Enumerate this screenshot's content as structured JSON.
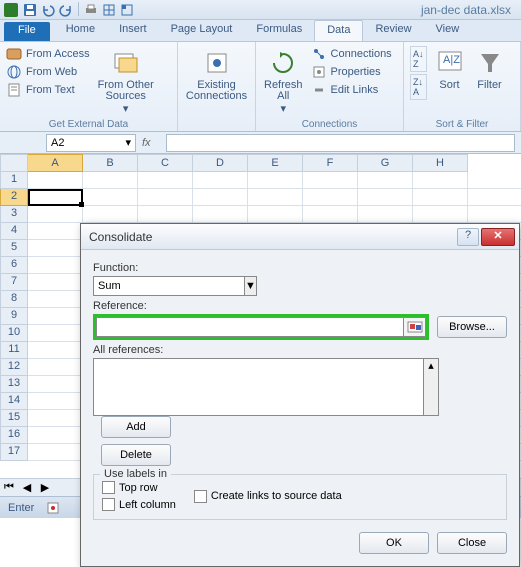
{
  "titlebar": {
    "filename": "jan-dec data.xlsx"
  },
  "tabs": {
    "file": "File",
    "home": "Home",
    "insert": "Insert",
    "page_layout": "Page Layout",
    "formulas": "Formulas",
    "data": "Data",
    "review": "Review",
    "view": "View"
  },
  "ribbon": {
    "from_access": "From Access",
    "from_web": "From Web",
    "from_text": "From Text",
    "from_other": "From Other\nSources",
    "existing": "Existing\nConnections",
    "refresh": "Refresh\nAll",
    "connections": "Connections",
    "properties": "Properties",
    "edit_links": "Edit Links",
    "sort_az": "A→Z",
    "sort": "Sort",
    "filter": "Filter",
    "group_getdata": "Get External Data",
    "group_conn": "Connections",
    "group_sortfilter": "Sort & Filter"
  },
  "namebox": "A2",
  "cols": [
    "A",
    "B",
    "C",
    "D",
    "E",
    "F",
    "G",
    "H"
  ],
  "rows": [
    "1",
    "2",
    "3",
    "4",
    "5",
    "6",
    "7",
    "8",
    "9",
    "10",
    "11",
    "12",
    "13",
    "14",
    "15",
    "16",
    "17"
  ],
  "status": "Enter",
  "dialog": {
    "title": "Consolidate",
    "function_label": "Function:",
    "function_value": "Sum",
    "reference_label": "Reference:",
    "reference_value": "",
    "browse": "Browse...",
    "allrefs_label": "All references:",
    "add": "Add",
    "delete": "Delete",
    "uselabels": "Use labels in",
    "toprow": "Top row",
    "leftcol": "Left column",
    "createlinks": "Create links to source data",
    "ok": "OK",
    "close": "Close"
  }
}
